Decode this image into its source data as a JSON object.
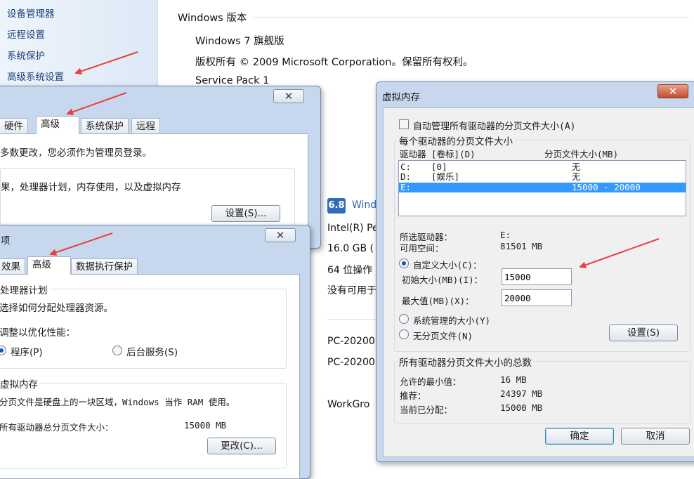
{
  "control_panel": {
    "sidebar": {
      "items": [
        "设备管理器",
        "远程设置",
        "系统保护",
        "高级系统设置"
      ]
    },
    "windows_edition": {
      "heading": "Windows 版本",
      "edition": "Windows 7 旗舰版",
      "copyright": "版权所有 © 2009 Microsoft Corporation。保留所有权利。",
      "service_pack": "Service Pack 1"
    },
    "system_info": {
      "rating_score": "6.8",
      "rating_label": "Wind",
      "processor": "Intel(R) Pe",
      "memory": "16.0 GB (",
      "system_type": "64 位操作",
      "pen_touch": "没有可用于",
      "computer_name": "PC-20200",
      "full_name": "PC-20200",
      "workgroup": "WorkGro"
    }
  },
  "system_properties": {
    "close_glyph": "✕",
    "tabs": [
      "硬件",
      "高级",
      "系统保护",
      "远程"
    ],
    "admin_note": "多数更改，您必须作为管理员登录。",
    "performance_desc": "果，处理器计划，内存使用，以及虚拟内存",
    "settings_button": "设置(S)..."
  },
  "performance_options": {
    "title": "项",
    "close_glyph": "✕",
    "tabs": [
      "效果",
      "高级",
      "数据执行保护"
    ],
    "processor_group": {
      "title": "处理器计划",
      "desc": "选择如何分配处理器资源。",
      "adjust_label": "调整以优化性能：",
      "option_programs": "程序(P)",
      "option_background": "后台服务(S)"
    },
    "vm_group": {
      "title": "虚拟内存",
      "desc": "分页文件是硬盘上的一块区域，Windows 当作 RAM 使用。",
      "total_label": "所有驱动器总分页文件大小：",
      "total_value": "15000 MB",
      "change_button": "更改(C)..."
    }
  },
  "virtual_memory": {
    "title": "虚拟内存",
    "close_glyph": "✕",
    "auto_manage_label": "自动管理所有驱动器的分页文件大小(A)",
    "per_drive_group_title": "每个驱动器的分页文件大小",
    "columns": {
      "drive": "驱动器 [卷标](D)",
      "size": "分页文件大小(MB)"
    },
    "drives": [
      {
        "drive": "C:",
        "label": "[0]",
        "size": "无"
      },
      {
        "drive": "D:",
        "label": "[娱乐]",
        "size": "无"
      },
      {
        "drive": "E:",
        "label": "",
        "size": "15000 - 20000"
      }
    ],
    "selected_drive_label": "所选驱动器：",
    "selected_drive_value": "E:",
    "free_space_label": "可用空间：",
    "free_space_value": "81501 MB",
    "custom_size_label": "自定义大小(C)：",
    "initial_size_label": "初始大小(MB)(I)：",
    "initial_size_value": "15000",
    "max_size_label": "最大值(MB)(X)：",
    "max_size_value": "20000",
    "system_managed_label": "系统管理的大小(Y)",
    "no_paging_label": "无分页文件(N)",
    "set_button": "设置(S)",
    "totals_group_title": "所有驱动器分页文件大小的总数",
    "min_allowed_label": "允许的最小值：",
    "min_allowed_value": "16 MB",
    "recommended_label": "推荐：",
    "recommended_value": "24397 MB",
    "allocated_label": "当前已分配：",
    "allocated_value": "15000 MB",
    "ok_button": "确定",
    "cancel_button": "取消"
  },
  "colors": {
    "selection": "#3399ff",
    "annotation_arrow": "#e8403a",
    "window_frame": "#c7d8ee"
  }
}
